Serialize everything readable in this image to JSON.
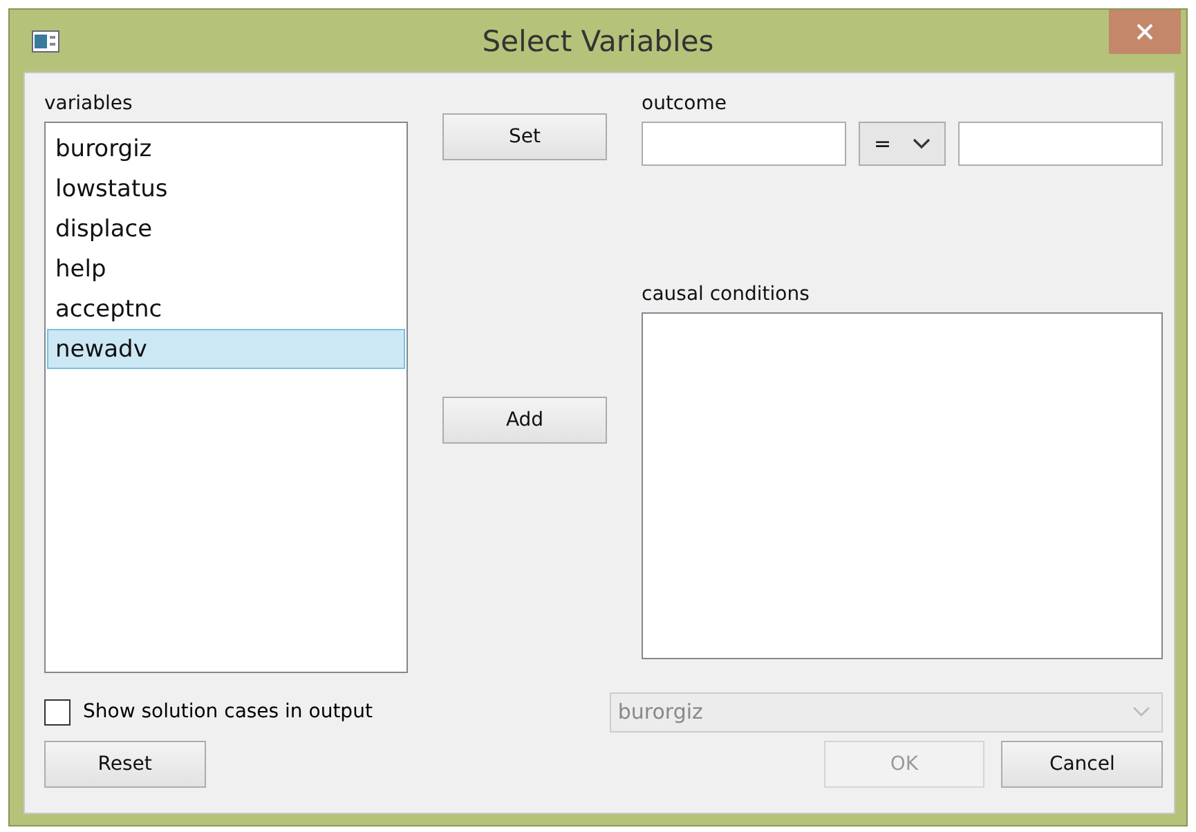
{
  "window": {
    "title": "Select Variables"
  },
  "variables": {
    "label": "variables",
    "items": [
      {
        "name": "burorgiz",
        "selected": false
      },
      {
        "name": "lowstatus",
        "selected": false
      },
      {
        "name": "displace",
        "selected": false
      },
      {
        "name": "help",
        "selected": false
      },
      {
        "name": "acceptnc",
        "selected": false
      },
      {
        "name": "newadv",
        "selected": true
      }
    ]
  },
  "set_button": {
    "label": "Set"
  },
  "add_button": {
    "label": "Add"
  },
  "outcome": {
    "label": "outcome",
    "operator": "="
  },
  "causal_conditions": {
    "label": "causal conditions"
  },
  "show_cases": {
    "label": "Show solution cases in output",
    "checked": false
  },
  "case_select": {
    "value": "burorgiz",
    "disabled": true
  },
  "buttons": [
    {
      "label": "Reset",
      "disabled": false
    },
    {
      "label": "OK",
      "disabled": true
    },
    {
      "label": "Cancel",
      "disabled": false
    }
  ]
}
